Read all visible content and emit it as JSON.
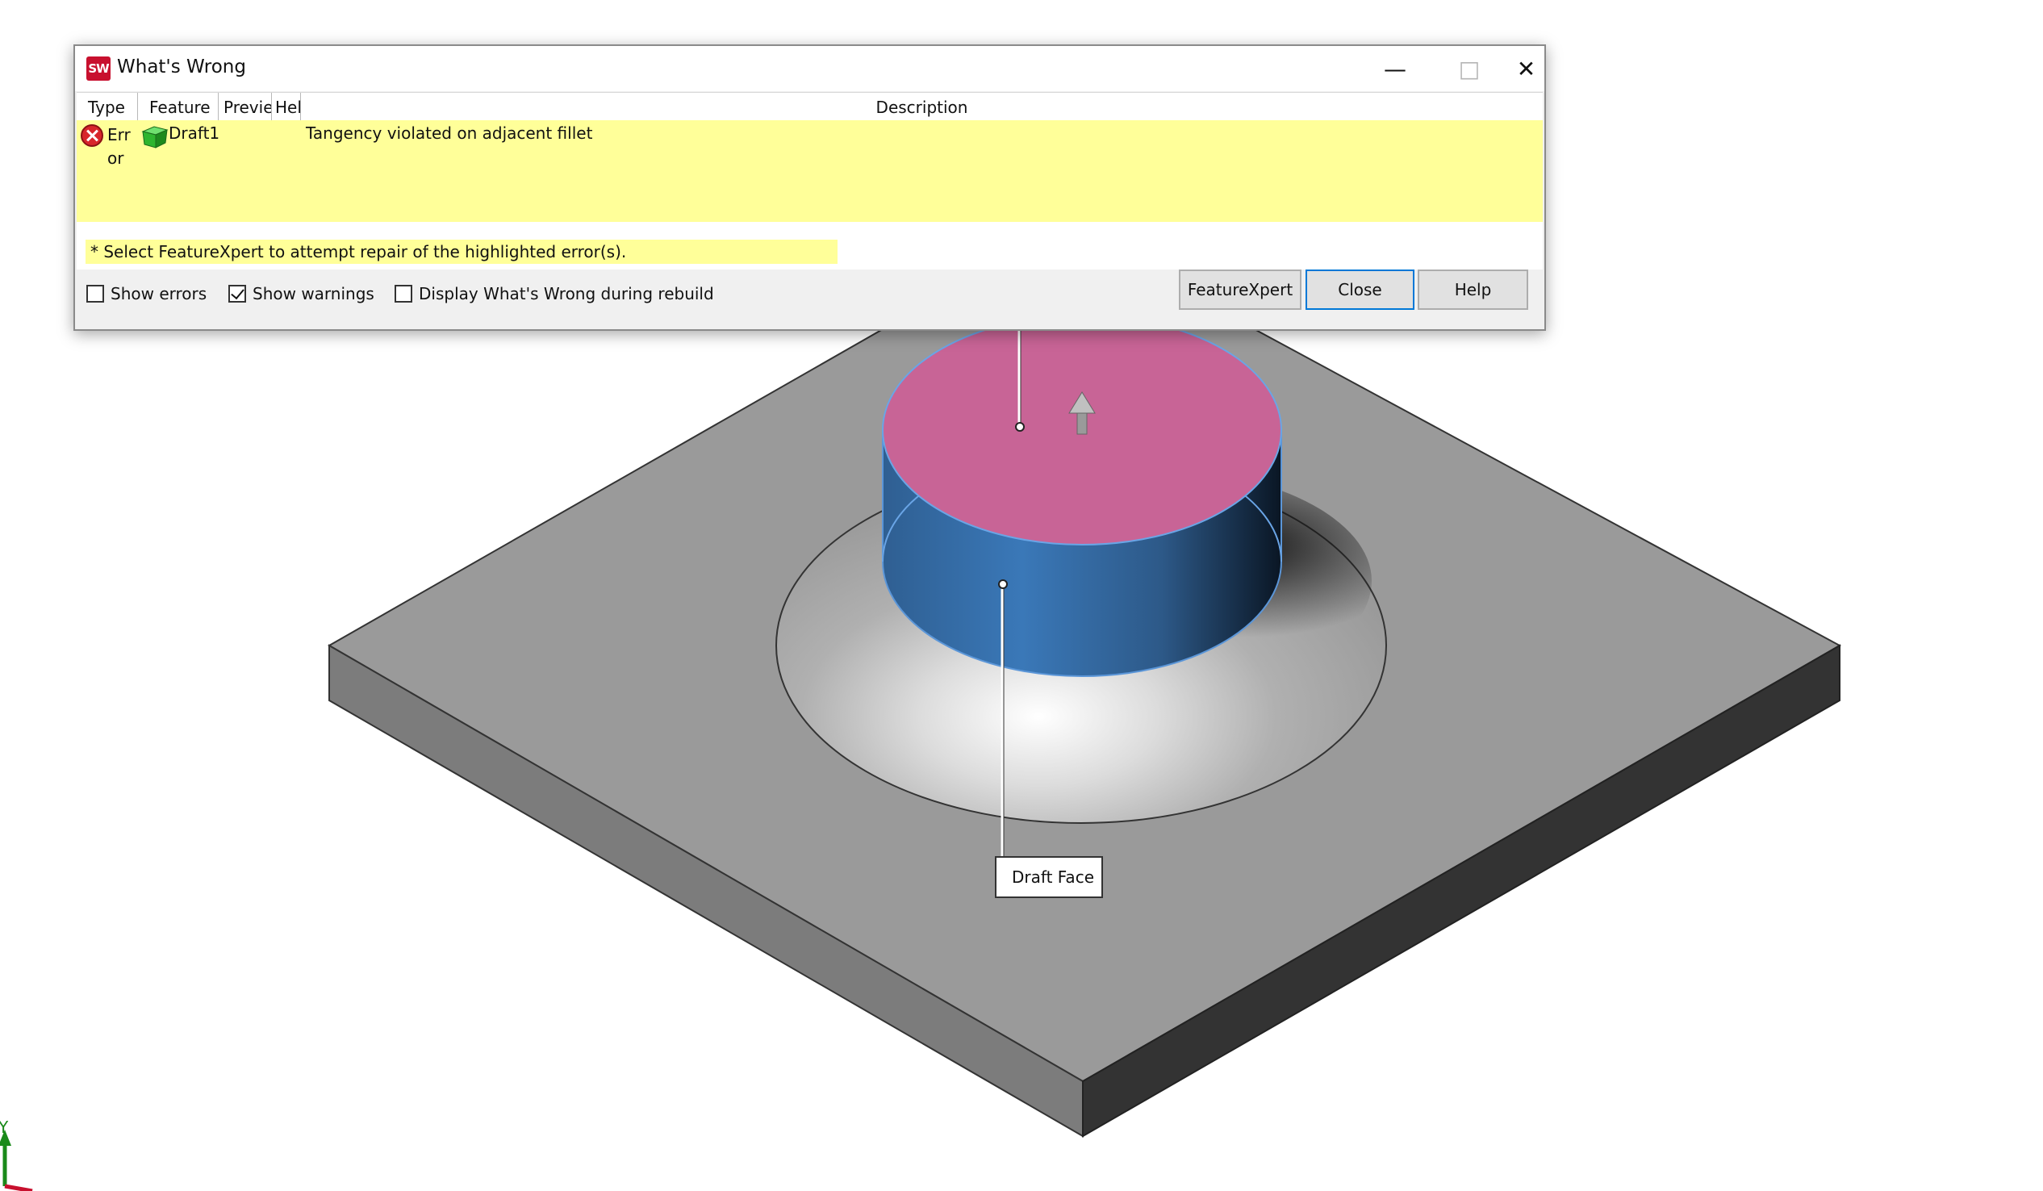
{
  "dialog": {
    "app_logo": "SW",
    "title": "What's Wrong",
    "window_controls": {
      "minimize": "—",
      "maximize": "□",
      "close": "✕"
    },
    "table": {
      "columns": [
        "Type",
        "Feature",
        "Previe",
        "Hel",
        "Description"
      ],
      "rows": [
        {
          "type": "Error",
          "type_icon": "error-icon",
          "feature": "Draft1",
          "feature_icon": "draft-feature-icon",
          "description": "Tangency violated on adjacent fillet"
        }
      ]
    },
    "hint": "* Select FeatureXpert to attempt repair of the highlighted error(s).",
    "checkboxes": [
      {
        "label": "Show errors",
        "checked": false
      },
      {
        "label": "Show warnings",
        "checked": true
      },
      {
        "label": "Display What's Wrong during rebuild",
        "checked": false
      }
    ],
    "buttons": {
      "featurexpert": "FeatureXpert",
      "close": "Close",
      "help": "Help"
    },
    "colors": {
      "highlight": "#ffff99",
      "error": "#d8262b",
      "selected_face_top": "#c86496",
      "draft_face": "#3a73b0"
    }
  },
  "viewport": {
    "callout_label": "Draft Face",
    "triad_axis_label": "Y"
  }
}
